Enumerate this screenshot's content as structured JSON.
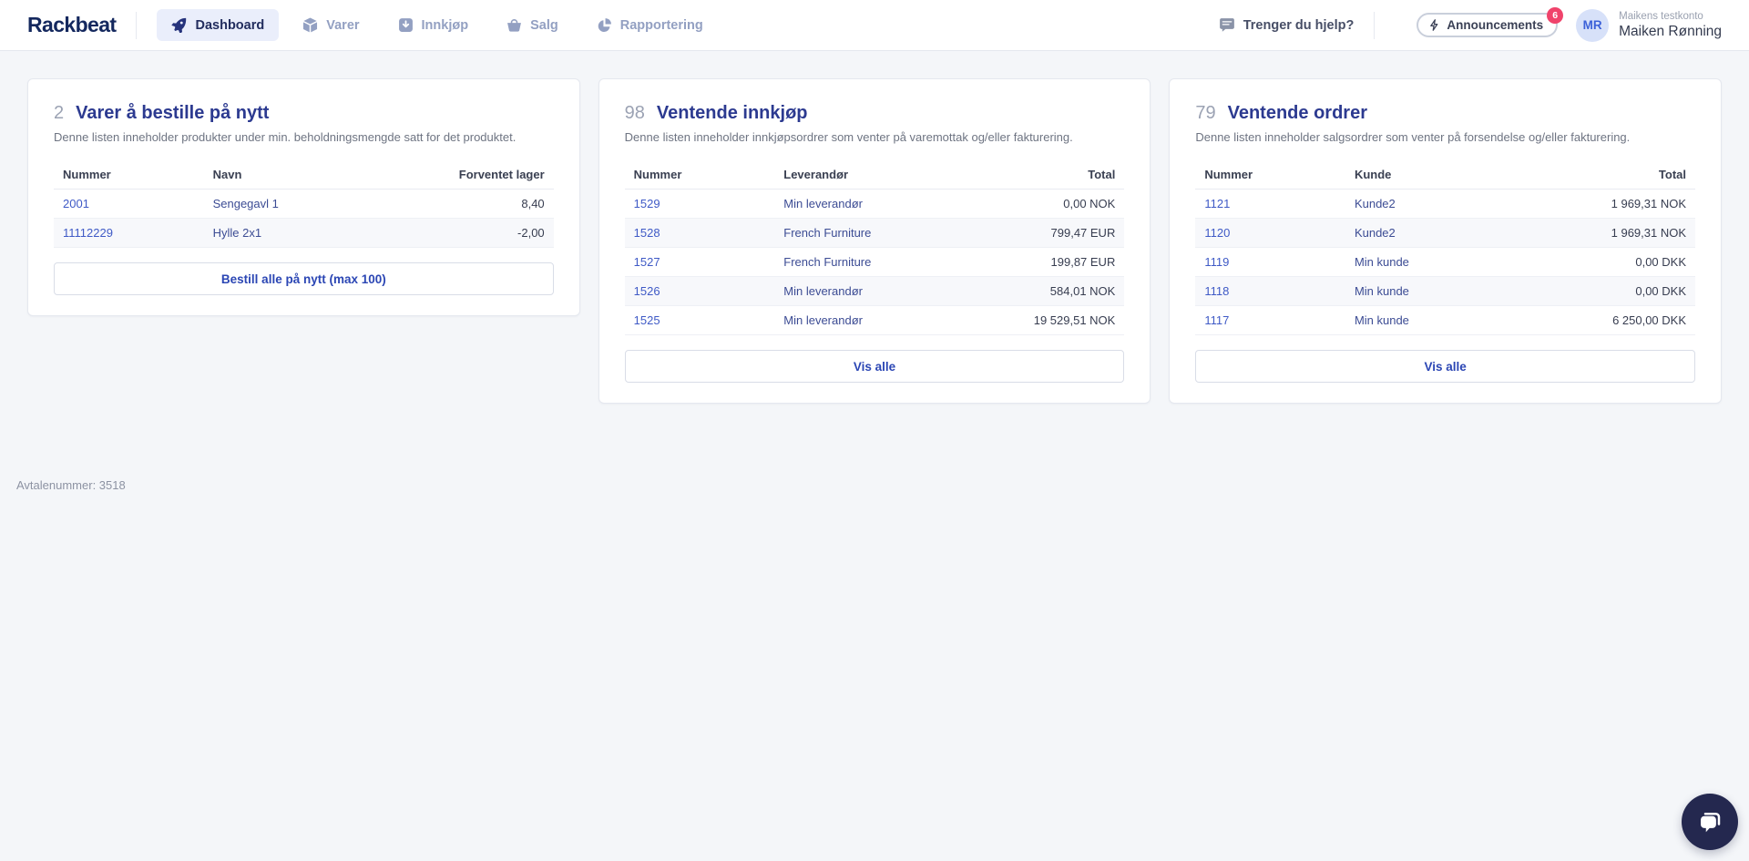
{
  "nav": {
    "brand": "Rackbeat",
    "items": [
      {
        "label": "Dashboard",
        "icon": "rocket-icon",
        "active": true
      },
      {
        "label": "Varer",
        "icon": "cube-icon",
        "active": false
      },
      {
        "label": "Innkjøp",
        "icon": "download-box-icon",
        "active": false
      },
      {
        "label": "Salg",
        "icon": "basket-icon",
        "active": false
      },
      {
        "label": "Rapportering",
        "icon": "pie-chart-icon",
        "active": false
      }
    ],
    "help_label": "Trenger du hjelp?",
    "announcements": {
      "label": "Announcements",
      "badge": "6",
      "icon": "lightning-icon"
    },
    "user": {
      "initials": "MR",
      "account": "Maikens testkonto",
      "name": "Maiken Rønning"
    }
  },
  "cards": [
    {
      "count": "2",
      "title": "Varer å bestille på nytt",
      "description": "Denne listen inneholder produkter under min. beholdningsmengde satt for det produktet.",
      "columns": [
        "Nummer",
        "Navn",
        "Forventet lager"
      ],
      "rows": [
        {
          "number": "2001",
          "name": "Sengegavl 1",
          "value": "8,40"
        },
        {
          "number": "11112229",
          "name": "Hylle 2x1",
          "value": "-2,00"
        }
      ],
      "action": "Bestill alle på nytt (max 100)"
    },
    {
      "count": "98",
      "title": "Ventende innkjøp",
      "description": "Denne listen inneholder innkjøpsordrer som venter på varemottak og/eller fakturering.",
      "columns": [
        "Nummer",
        "Leverandør",
        "Total"
      ],
      "rows": [
        {
          "number": "1529",
          "name": "Min leverandør",
          "value": "0,00 NOK"
        },
        {
          "number": "1528",
          "name": "French Furniture",
          "value": "799,47 EUR"
        },
        {
          "number": "1527",
          "name": "French Furniture",
          "value": "199,87 EUR"
        },
        {
          "number": "1526",
          "name": "Min leverandør",
          "value": "584,01 NOK"
        },
        {
          "number": "1525",
          "name": "Min leverandør",
          "value": "19 529,51 NOK"
        }
      ],
      "action": "Vis alle"
    },
    {
      "count": "79",
      "title": "Ventende ordrer",
      "description": "Denne listen inneholder salgsordrer som venter på forsendelse og/eller fakturering.",
      "columns": [
        "Nummer",
        "Kunde",
        "Total"
      ],
      "rows": [
        {
          "number": "1121",
          "name": "Kunde2",
          "value": "1 969,31 NOK"
        },
        {
          "number": "1120",
          "name": "Kunde2",
          "value": "1 969,31 NOK"
        },
        {
          "number": "1119",
          "name": "Min kunde",
          "value": "0,00 DKK"
        },
        {
          "number": "1118",
          "name": "Min kunde",
          "value": "0,00 DKK"
        },
        {
          "number": "1117",
          "name": "Min kunde",
          "value": "6 250,00 DKK"
        }
      ],
      "action": "Vis alle"
    }
  ],
  "footer": {
    "agreement": "Avtalenummer: 3518"
  },
  "icons": {
    "fab": "chat-bubbles-icon",
    "help": "chat-icon"
  },
  "colors": {
    "brand_navy": "#14285e",
    "title_indigo": "#2c3a90",
    "link_blue": "#3f5ac6",
    "link_navy": "#3c4c94",
    "nav_inactive": "#93a0c2",
    "nav_active_bg": "#eaeefb",
    "badge_red": "#f0436b",
    "fab_navy": "#24284f",
    "page_bg": "#f4f6f9"
  }
}
